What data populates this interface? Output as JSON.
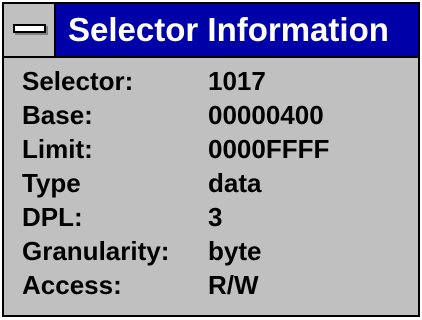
{
  "window": {
    "title": "Selector Information",
    "system_menu_icon": "system-menu-icon"
  },
  "fields": [
    {
      "label": "Selector:",
      "value": "1017"
    },
    {
      "label": "Base:",
      "value": "00000400"
    },
    {
      "label": "Limit:",
      "value": "0000FFFF"
    },
    {
      "label": "Type",
      "value": "data"
    },
    {
      "label": "DPL:",
      "value": "3"
    },
    {
      "label": "Granularity:",
      "value": "byte"
    },
    {
      "label": "Access:",
      "value": "R/W"
    }
  ],
  "colors": {
    "titlebar": "#0000a8",
    "window_background": "#c0c0c0",
    "title_text": "#ffffff"
  }
}
